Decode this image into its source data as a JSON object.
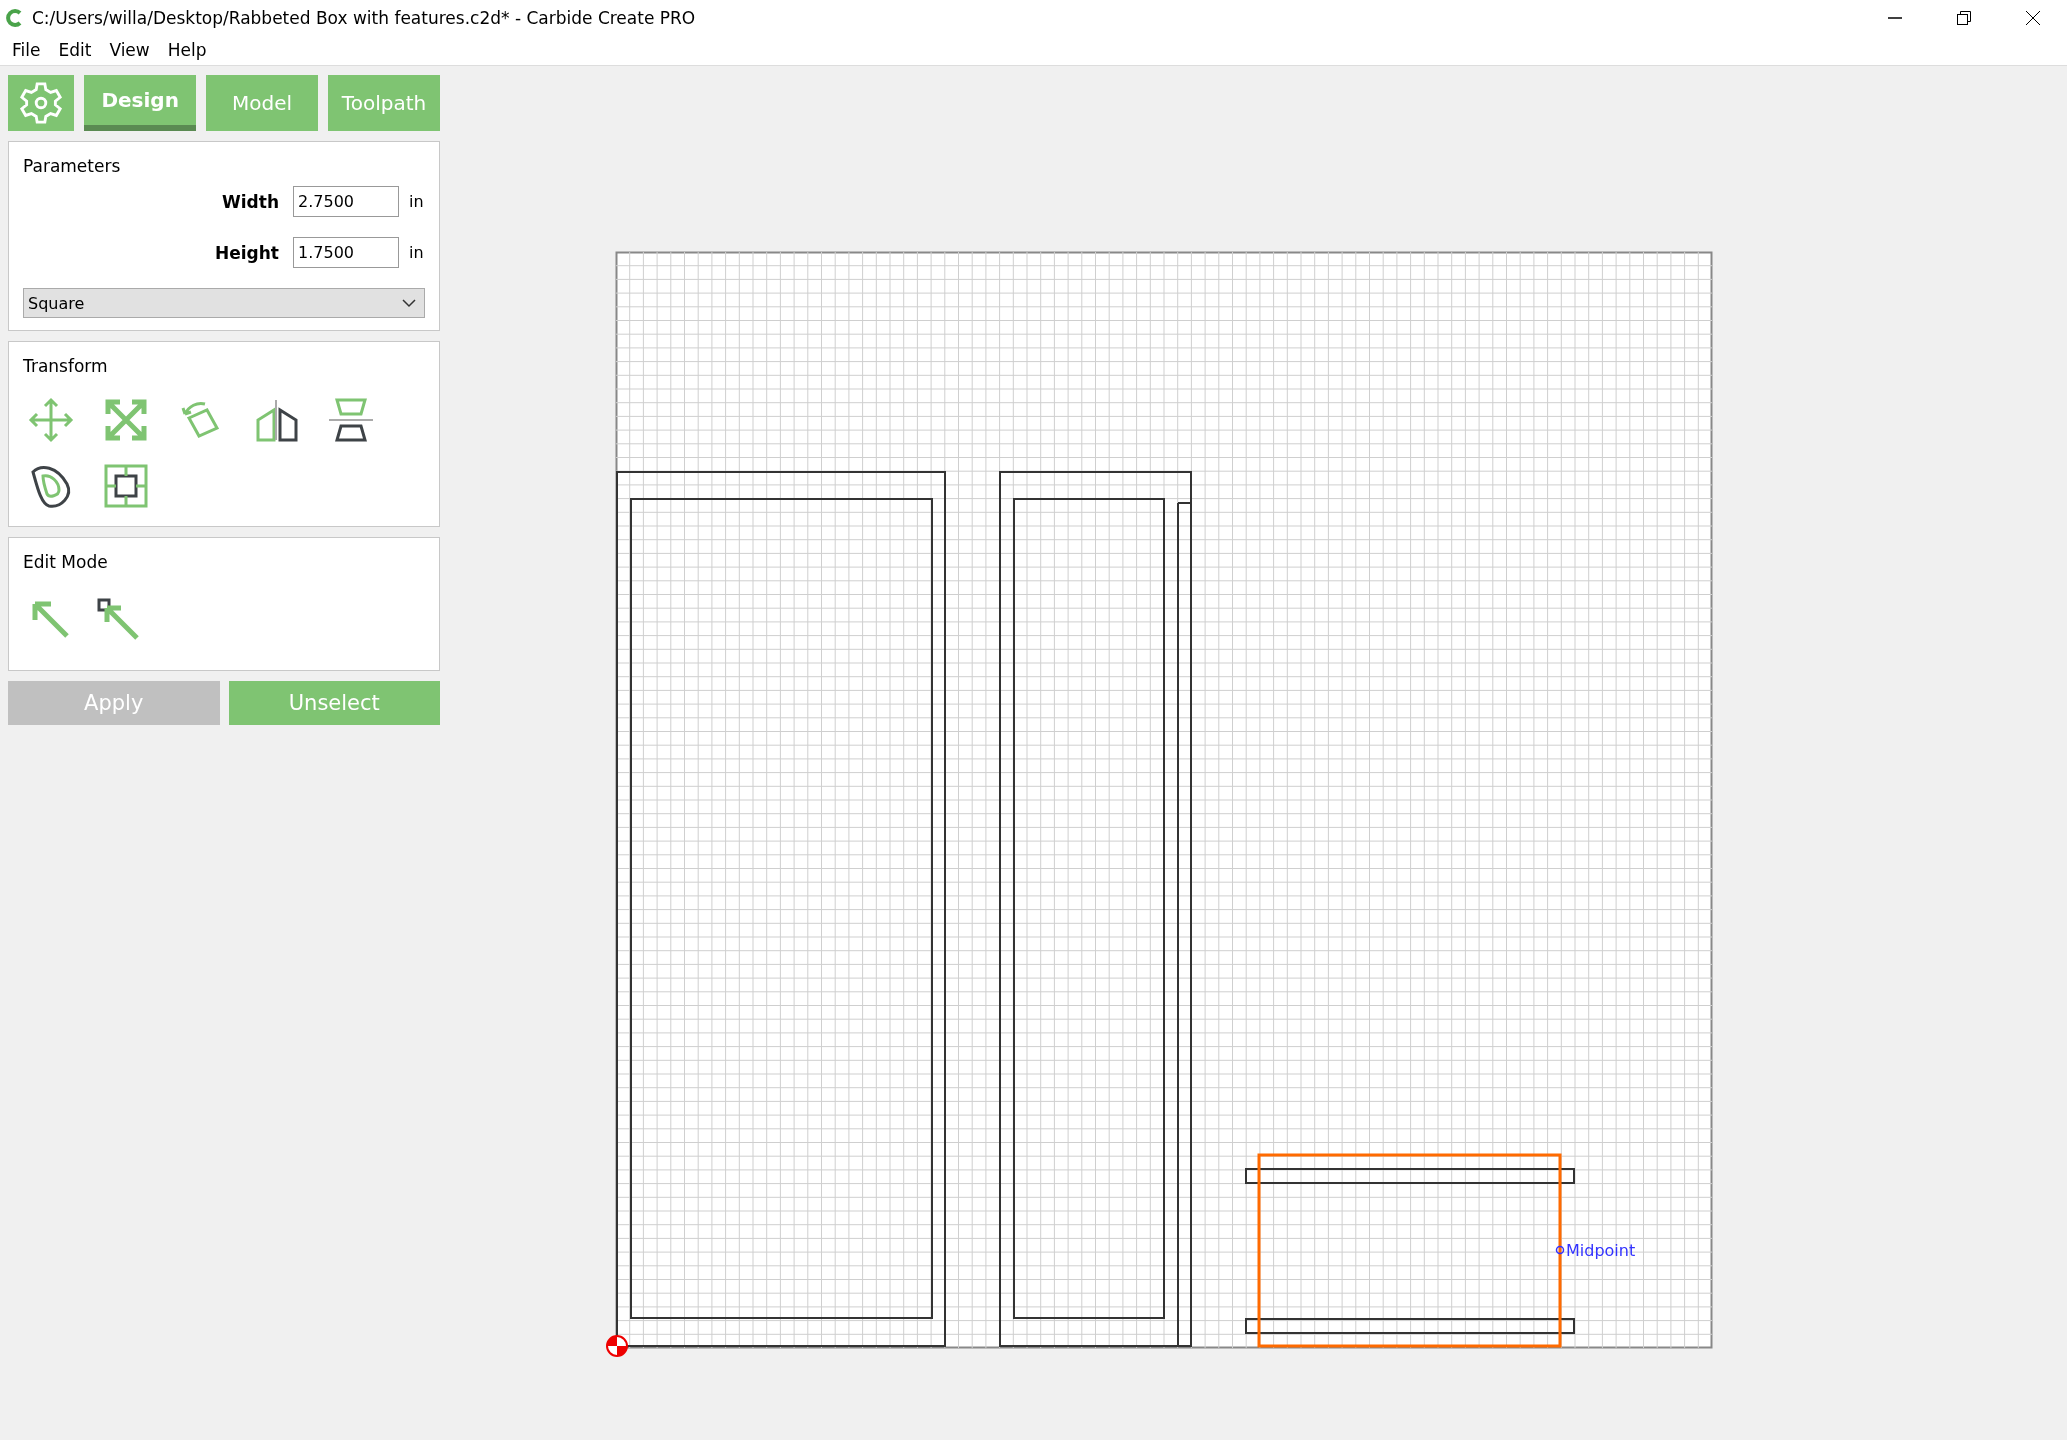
{
  "window": {
    "title": "C:/Users/willa/Desktop/Rabbeted Box with features.c2d* - Carbide Create PRO"
  },
  "menu": [
    "File",
    "Edit",
    "View",
    "Help"
  ],
  "tabs": [
    {
      "label": "Design",
      "selected": true
    },
    {
      "label": "Model",
      "selected": false
    },
    {
      "label": "Toolpath",
      "selected": false
    }
  ],
  "parameters": {
    "title": "Parameters",
    "fields": [
      {
        "label": "Width",
        "value": "2.7500",
        "unit": "in"
      },
      {
        "label": "Height",
        "value": "1.7500",
        "unit": "in"
      }
    ],
    "shape_select": "Square"
  },
  "transform": {
    "title": "Transform"
  },
  "edit_mode": {
    "title": "Edit Mode"
  },
  "buttons": [
    {
      "label": "Apply",
      "disabled": true
    },
    {
      "label": "Unselect",
      "disabled": false
    }
  ],
  "canvas": {
    "shapes": [
      {
        "selected": false
      },
      {
        "selected": false
      },
      {
        "selected": false
      },
      {
        "selected": false
      },
      {
        "selected": true
      }
    ],
    "snap_label": "Midpoint"
  }
}
